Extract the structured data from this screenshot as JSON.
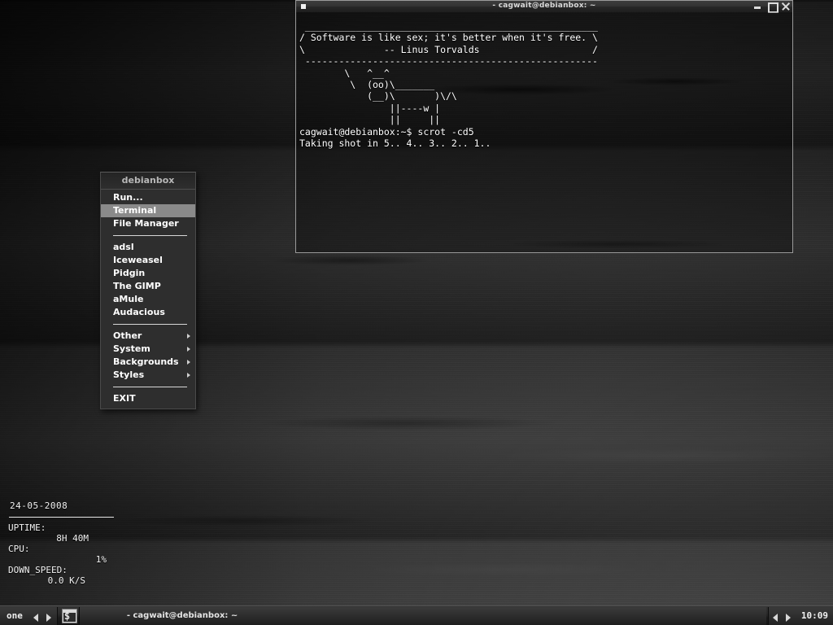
{
  "desktop": {
    "wallpaper_name": "dark-wood-grain",
    "accent_color": "#22ee22",
    "panel_color": "#2a2a2a"
  },
  "conky": {
    "date": "24-05-2008",
    "rows": [
      {
        "label": "UPTIME:",
        "value": "8H 40M"
      },
      {
        "label": "CPU:",
        "value": "1%"
      },
      {
        "label": "DOWN_SPEED:",
        "value": "0.0 K/S"
      }
    ]
  },
  "root_menu": {
    "header": "debianbox",
    "items": [
      {
        "label": "Run...",
        "selected": false,
        "submenu": false
      },
      {
        "label": "Terminal",
        "selected": true,
        "submenu": false
      },
      {
        "label": "File Manager",
        "selected": false,
        "submenu": false
      },
      {
        "separator": true
      },
      {
        "label": "adsl",
        "selected": false,
        "submenu": false
      },
      {
        "label": "Iceweasel",
        "selected": false,
        "submenu": false
      },
      {
        "label": "Pidgin",
        "selected": false,
        "submenu": false
      },
      {
        "label": "The GIMP",
        "selected": false,
        "submenu": false
      },
      {
        "label": "aMule",
        "selected": false,
        "submenu": false
      },
      {
        "label": "Audacious",
        "selected": false,
        "submenu": false
      },
      {
        "separator": true
      },
      {
        "label": "Other",
        "selected": false,
        "submenu": true
      },
      {
        "label": "System",
        "selected": false,
        "submenu": true
      },
      {
        "label": "Backgrounds",
        "selected": false,
        "submenu": true
      },
      {
        "label": "Styles",
        "selected": false,
        "submenu": true
      },
      {
        "separator": true
      },
      {
        "label": "EXIT",
        "selected": false,
        "submenu": false
      }
    ]
  },
  "terminal": {
    "title": "- cagwait@debianbox: ~",
    "window_icon": "window-menu-icon",
    "buttons": {
      "minimize": "minimize-icon",
      "maximize": "maximize-icon",
      "close": "close-icon"
    },
    "quote": "Software is like sex; it's better when it's free.",
    "attribution": "-- Linus Torvalds",
    "prompt": "cagwait@debianbox:~$",
    "command": "scrot -cd5",
    "output": "Taking shot in 5.. 4.. 3.. 2.. 1..",
    "cursor_color": "#22ee22",
    "screen_text": " ____________________________________________________\n/ Software is like sex; it's better when it's free. \\\n\\              -- Linus Torvalds                    /\n ----------------------------------------------------\n        \\   ^__^\n         \\  (oo)\\_______\n            (__)\\       )\\/\\\n                ||----w |\n                ||     ||\ncagwait@debianbox:~$ scrot -cd5\nTaking shot in 5.. 4.. 3.. 2.. 1.. "
  },
  "taskbar": {
    "workspace": "one",
    "prev_workspace_icon": "arrow-left-icon",
    "next_workspace_icon": "arrow-right-icon",
    "launcher_icon": "terminal-icon",
    "active_task": "- cagwait@debianbox: ~",
    "prev_task_icon": "arrow-left-icon",
    "next_task_icon": "arrow-right-icon",
    "clock": "10:09"
  }
}
